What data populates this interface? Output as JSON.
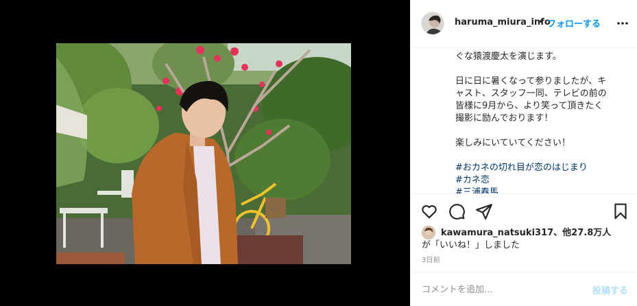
{
  "post": {
    "media_alt": "Man in orange jacket in a garden",
    "header": {
      "username": "haruma_miura_info",
      "separator": "•",
      "follow_label": "フォローする",
      "more_icon": "more-horizontal-icon"
    },
    "caption_lines": [
      "ぐな猿渡慶太を演じます。",
      "",
      "日に日に暑くなって参りましたが、キ",
      "ャスト、スタッフ一同、テレビの前の",
      "皆様に9月から、より笑って頂きたく",
      "撮影に励んでおります！",
      "",
      "楽しみにいていてください！",
      ""
    ],
    "hashtags": [
      "#おカネの切れ目が恋のはじまり",
      "#カネ恋",
      "#三浦春馬"
    ],
    "actions": {
      "like_icon": "heart-icon",
      "comment_icon": "comment-icon",
      "share_icon": "share-icon",
      "save_icon": "bookmark-icon"
    },
    "likes": {
      "liker": "kawamura_natsuki317",
      "others": "、他27.8万人",
      "suffix": "が「いいね！」しました"
    },
    "timestamp": "3日前",
    "comment": {
      "placeholder": "コメントを追加...",
      "post_label": "投稿する"
    },
    "colors": {
      "link": "#0095f6",
      "hashtag": "#00376b",
      "text": "#262626",
      "muted": "#8e8e8e",
      "post_disabled": "#b2dffc"
    }
  }
}
